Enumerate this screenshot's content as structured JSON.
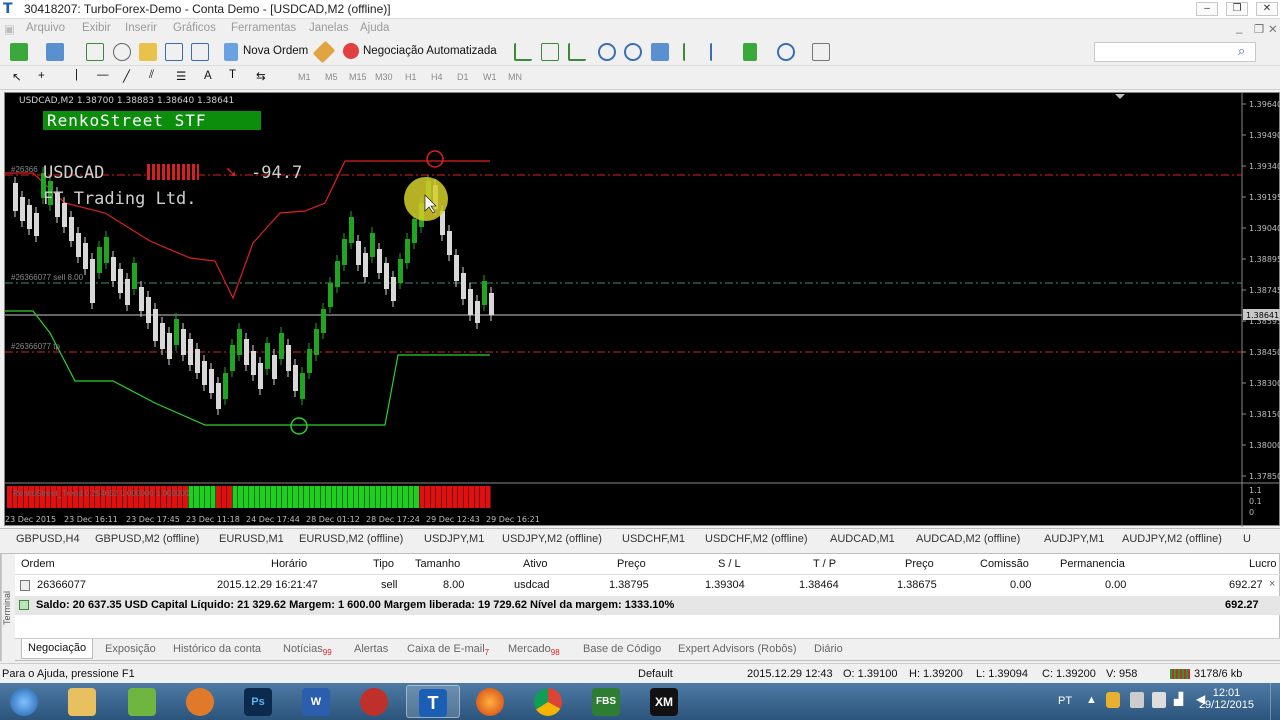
{
  "window": {
    "title": "30418207: TurboForex-Demo - Conta Demo - [USDCAD,M2 (offline)]"
  },
  "menu": [
    "Arquivo",
    "Exibir",
    "Inserir",
    "Gráficos",
    "Ferramentas",
    "Janelas",
    "Ajuda"
  ],
  "toolbar": {
    "new_order": "Nova Ordem",
    "auto_trading": "Negociação Automatizada"
  },
  "timeframes": [
    "M1",
    "M5",
    "M15",
    "M30",
    "H1",
    "H4",
    "D1",
    "W1",
    "MN"
  ],
  "chart": {
    "header": "USDCAD,M2  1.38700 1.38883 1.38640 1.38641",
    "banner": "RenkoStreet STF",
    "symbol": "USDCAD",
    "value": "-94.7",
    "company": "FT Trading Ltd.",
    "order_label_top": "#26366",
    "order_label_sell": "#26366077 sell 8.00",
    "order_label_tp": "#26366077 tp",
    "indicator_label": "RenkoStreet_Trend 0.254652 0.000000 1.000000",
    "price_ticks": [
      "1.39640",
      "1.39490",
      "1.39340",
      "1.39195",
      "1.39040",
      "1.38895",
      "1.38745",
      "1.38595",
      "1.38450",
      "1.38300",
      "1.38150",
      "1.38000",
      "1.37850"
    ],
    "current_price": "1.38641",
    "sub_ticks": [
      "1.1",
      "0.1",
      "0"
    ],
    "time_labels": [
      "23 Dec 2015",
      "23 Dec 16:11",
      "23 Dec 17:45",
      "23 Dec 11:18",
      "24 Dec 17:44",
      "28 Dec 01:12",
      "28 Dec 17:24",
      "29 Dec 12:43",
      "29 Dec 16:21"
    ]
  },
  "symbol_tabs": [
    "GBPUSD,H4",
    "GBPUSD,M2 (offline)",
    "EURUSD,M1",
    "EURUSD,M2 (offline)",
    "USDJPY,M1",
    "USDJPY,M2 (offline)",
    "USDCHF,M1",
    "USDCHF,M2 (offline)",
    "AUDCAD,M1",
    "AUDCAD,M2 (offline)",
    "AUDJPY,M1",
    "AUDJPY,M2 (offline)",
    "U"
  ],
  "terminal": {
    "side_label": "Terminal",
    "headers": {
      "ordem": "Ordem",
      "horario": "Horário",
      "tipo": "Tipo",
      "tamanho": "Tamanho",
      "ativo": "Ativo",
      "preco": "Preço",
      "sl": "S / L",
      "tp": "T / P",
      "preco2": "Preço",
      "comissao": "Comissão",
      "permanencia": "Permanencia",
      "lucro": "Lucro"
    },
    "row": {
      "ordem": "26366077",
      "horario": "2015.12.29 16:21:47",
      "tipo": "sell",
      "tamanho": "8.00",
      "ativo": "usdcad",
      "preco": "1.38795",
      "sl": "1.39304",
      "tp": "1.38464",
      "preco2": "1.38675",
      "comissao": "0.00",
      "permanencia": "0.00",
      "lucro": "692.27"
    },
    "balance": "Saldo: 20 637.35 USD  Capital Líquido: 21 329.62  Margem: 1 600.00  Margem liberada: 19 729.62  Nível da margem: 1333.10%",
    "balance_profit": "692.27",
    "tabs": [
      {
        "label": "Negociação"
      },
      {
        "label": "Exposição"
      },
      {
        "label": "Histórico da conta"
      },
      {
        "label": "Notícias",
        "badge": "99"
      },
      {
        "label": "Alertas"
      },
      {
        "label": "Caixa de E-mail",
        "badge": "7"
      },
      {
        "label": "Mercado",
        "badge": "98"
      },
      {
        "label": "Base de Código"
      },
      {
        "label": "Expert Advisors (Robôs)"
      },
      {
        "label": "Diário"
      }
    ]
  },
  "statusbar": {
    "help": "Para o Ajuda, pressione F1",
    "profile": "Default",
    "time": "2015.12.29 12:43",
    "open": "O: 1.39100",
    "high": "H: 1.39200",
    "low": "L: 1.39094",
    "close": "C: 1.39200",
    "volume": "V: 958",
    "traffic": "3178/6 kb"
  },
  "taskbar": {
    "lang": "PT",
    "time": "12:01",
    "date": "29/12/2015"
  },
  "colors": {
    "chart_bg": "#000000",
    "bull": "#1fa51f",
    "bear": "#d8d8d8",
    "sl_line": "#e02020",
    "tp_line": "#2bd12b",
    "banner": "#0c8e0c"
  }
}
